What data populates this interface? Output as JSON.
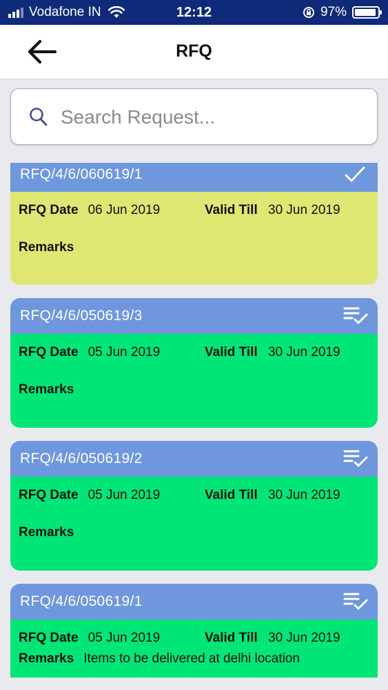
{
  "status_bar": {
    "carrier": "Vodafone IN",
    "time": "12:12",
    "battery": "97%",
    "battery_level": 0.97
  },
  "nav": {
    "title": "RFQ"
  },
  "search": {
    "placeholder": "Search Request...",
    "value": ""
  },
  "labels": {
    "rfq_date": "RFQ Date",
    "valid_till": "Valid Till",
    "remarks": "Remarks"
  },
  "colors": {
    "header_blue": "#6f97dd",
    "status_navy": "#0e2a78",
    "card_yellow": "#dfe773",
    "card_green": "#00e676"
  },
  "cards": [
    {
      "id": "RFQ/4/6/060619/1",
      "rfq_date": "06 Jun 2019",
      "valid_till": "30 Jun 2019",
      "remarks": "",
      "icon": "check-icon",
      "color": "#dfe773"
    },
    {
      "id": "RFQ/4/6/050619/3",
      "rfq_date": "05 Jun 2019",
      "valid_till": "30 Jun 2019",
      "remarks": "",
      "icon": "playlist-check-icon",
      "color": "#00e676"
    },
    {
      "id": "RFQ/4/6/050619/2",
      "rfq_date": "05 Jun 2019",
      "valid_till": "30 Jun 2019",
      "remarks": "",
      "icon": "playlist-check-icon",
      "color": "#00e676"
    },
    {
      "id": "RFQ/4/6/050619/1",
      "rfq_date": "05 Jun 2019",
      "valid_till": "30 Jun 2019",
      "remarks": "Items to be delivered at delhi location",
      "icon": "playlist-check-icon",
      "color": "#00e676"
    }
  ]
}
